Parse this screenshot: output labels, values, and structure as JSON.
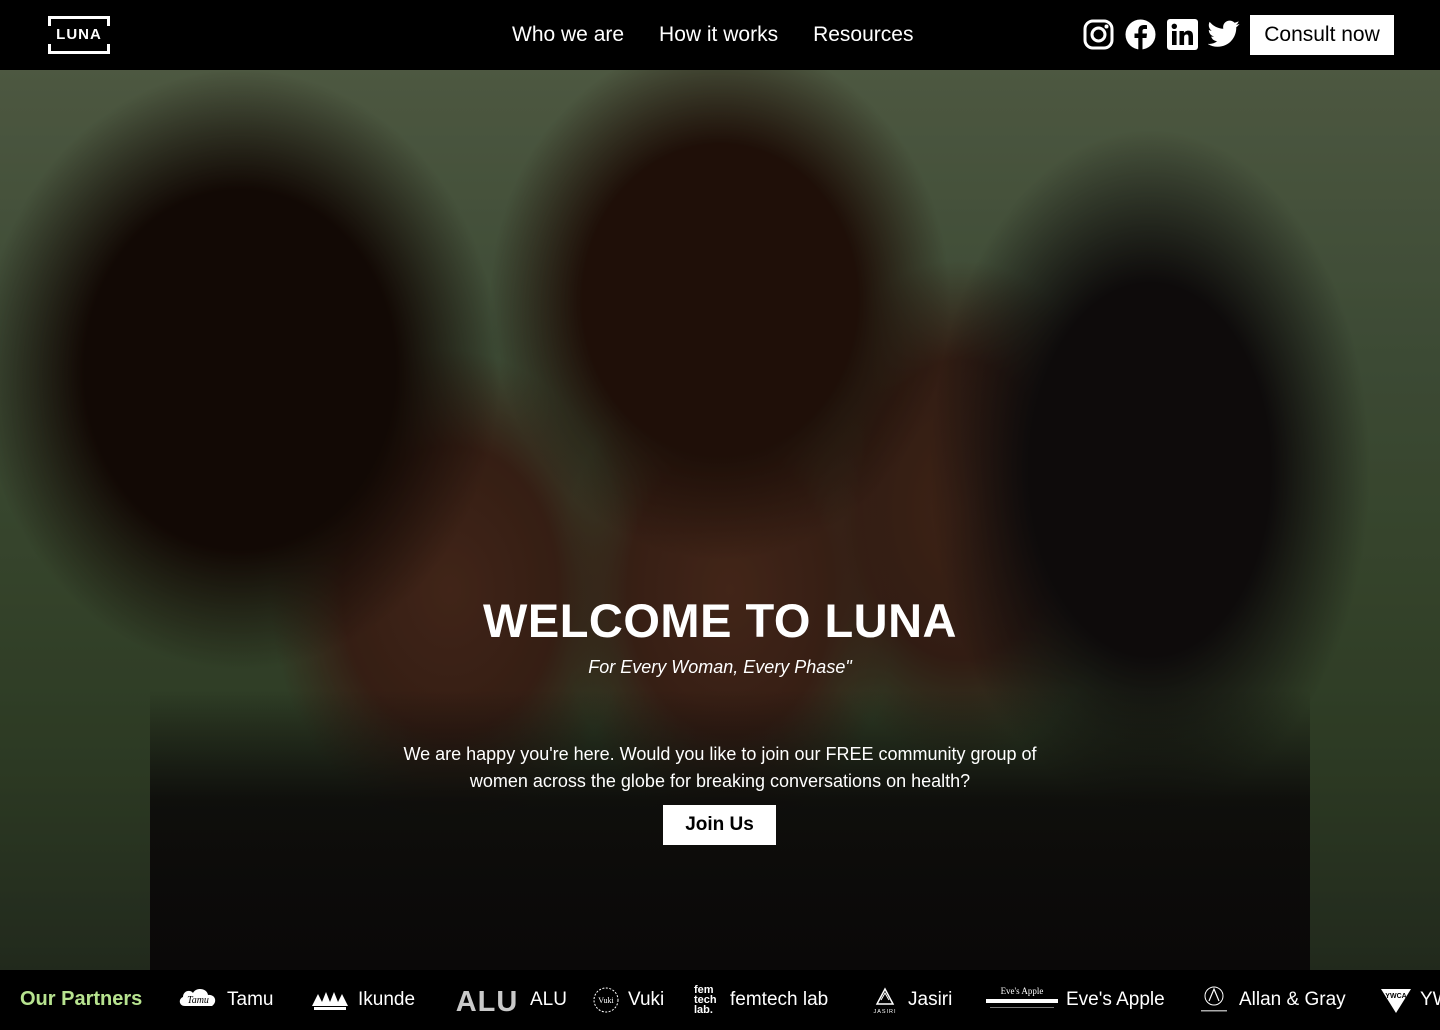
{
  "header": {
    "logo_text": "LUNA",
    "nav": [
      {
        "label": "Who we are"
      },
      {
        "label": "How it works"
      },
      {
        "label": "Resources"
      }
    ],
    "social_icons": [
      "instagram-icon",
      "facebook-icon",
      "linkedin-icon",
      "twitter-icon"
    ],
    "cta_label": "Consult now"
  },
  "hero": {
    "title": "WELCOME TO LUNA",
    "subtitle": "For Every Woman, Every Phase\"",
    "text": "We are happy you're here.  Would you like to join our FREE community group of women across the globe for breaking conversations on health?",
    "button_label": "Join Us"
  },
  "partners": {
    "label": "Our Partners",
    "items": [
      {
        "name": "Tamu",
        "logo_text": "Tamu"
      },
      {
        "name": "Ikunde",
        "logo_text": ""
      },
      {
        "name": "ALU",
        "logo_text": "ALU"
      },
      {
        "name": "Vuki",
        "logo_text": "Vuki"
      },
      {
        "name": "femtech lab",
        "logo_text": "fem tech lab."
      },
      {
        "name": "Jasiri",
        "logo_text": "JASIRI"
      },
      {
        "name": "Eve's Apple",
        "logo_text": "Eve's Apple"
      },
      {
        "name": "Allan & Gray",
        "logo_text": ""
      },
      {
        "name": "YW",
        "logo_text": "YWCA"
      }
    ]
  },
  "colors": {
    "header_bg": "#000000",
    "partners_label": "#b7e38f",
    "button_bg": "#ffffff"
  }
}
